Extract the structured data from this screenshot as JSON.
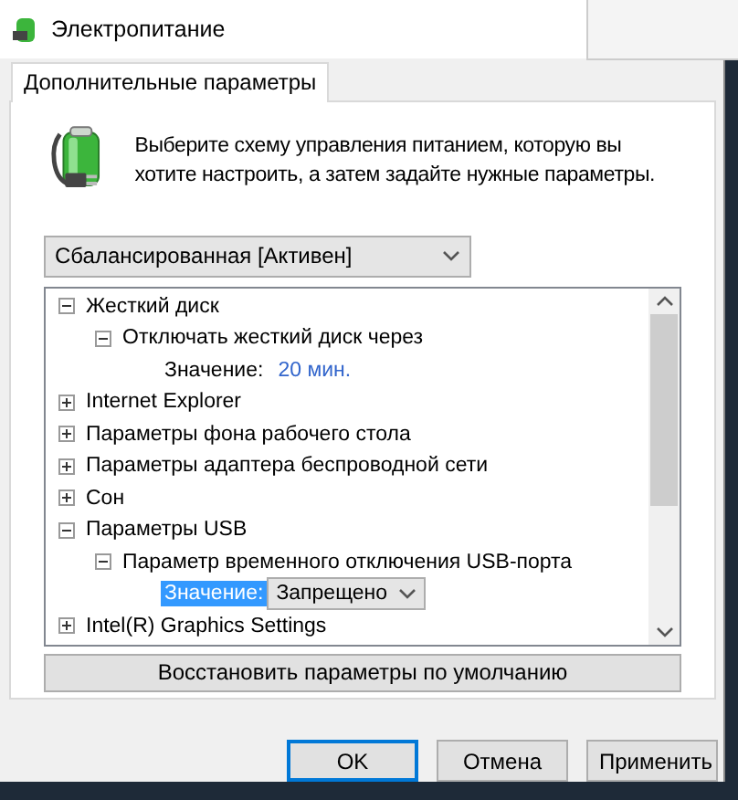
{
  "window": {
    "title": "Электропитание"
  },
  "tabs": [
    {
      "label": "Дополнительные параметры",
      "selected": true
    }
  ],
  "intro": "Выберите схему управления питанием, которую вы хотите настроить, а затем задайте нужные параметры.",
  "plan_select": {
    "value": "Сбалансированная [Активен]"
  },
  "tree": [
    {
      "kind": "group",
      "label": "Жесткий диск",
      "expanded": true,
      "children": [
        {
          "kind": "group",
          "label": "Отключать жесткий диск через",
          "expanded": true,
          "children": [
            {
              "kind": "value",
              "label": "Значение:",
              "value": "20 мин.",
              "selected": false
            }
          ]
        }
      ]
    },
    {
      "kind": "group",
      "label": "Internet Explorer",
      "expanded": false
    },
    {
      "kind": "group",
      "label": "Параметры фона рабочего стола",
      "expanded": false
    },
    {
      "kind": "group",
      "label": "Параметры адаптера беспроводной сети",
      "expanded": false
    },
    {
      "kind": "group",
      "label": "Сон",
      "expanded": false
    },
    {
      "kind": "group",
      "label": "Параметры USB",
      "expanded": true,
      "children": [
        {
          "kind": "group",
          "label": "Параметр временного отключения USB-порта",
          "expanded": true,
          "children": [
            {
              "kind": "dropdown",
              "label": "Значение:",
              "value": "Запрещено",
              "selected": true
            }
          ]
        }
      ]
    },
    {
      "kind": "group",
      "label": "Intel(R) Graphics Settings",
      "expanded": false
    }
  ],
  "restore_button": "Восстановить параметры по умолчанию",
  "buttons": [
    {
      "label": "OK",
      "default": true
    },
    {
      "label": "Отмена",
      "default": false
    },
    {
      "label": "Применить",
      "default": false
    }
  ]
}
